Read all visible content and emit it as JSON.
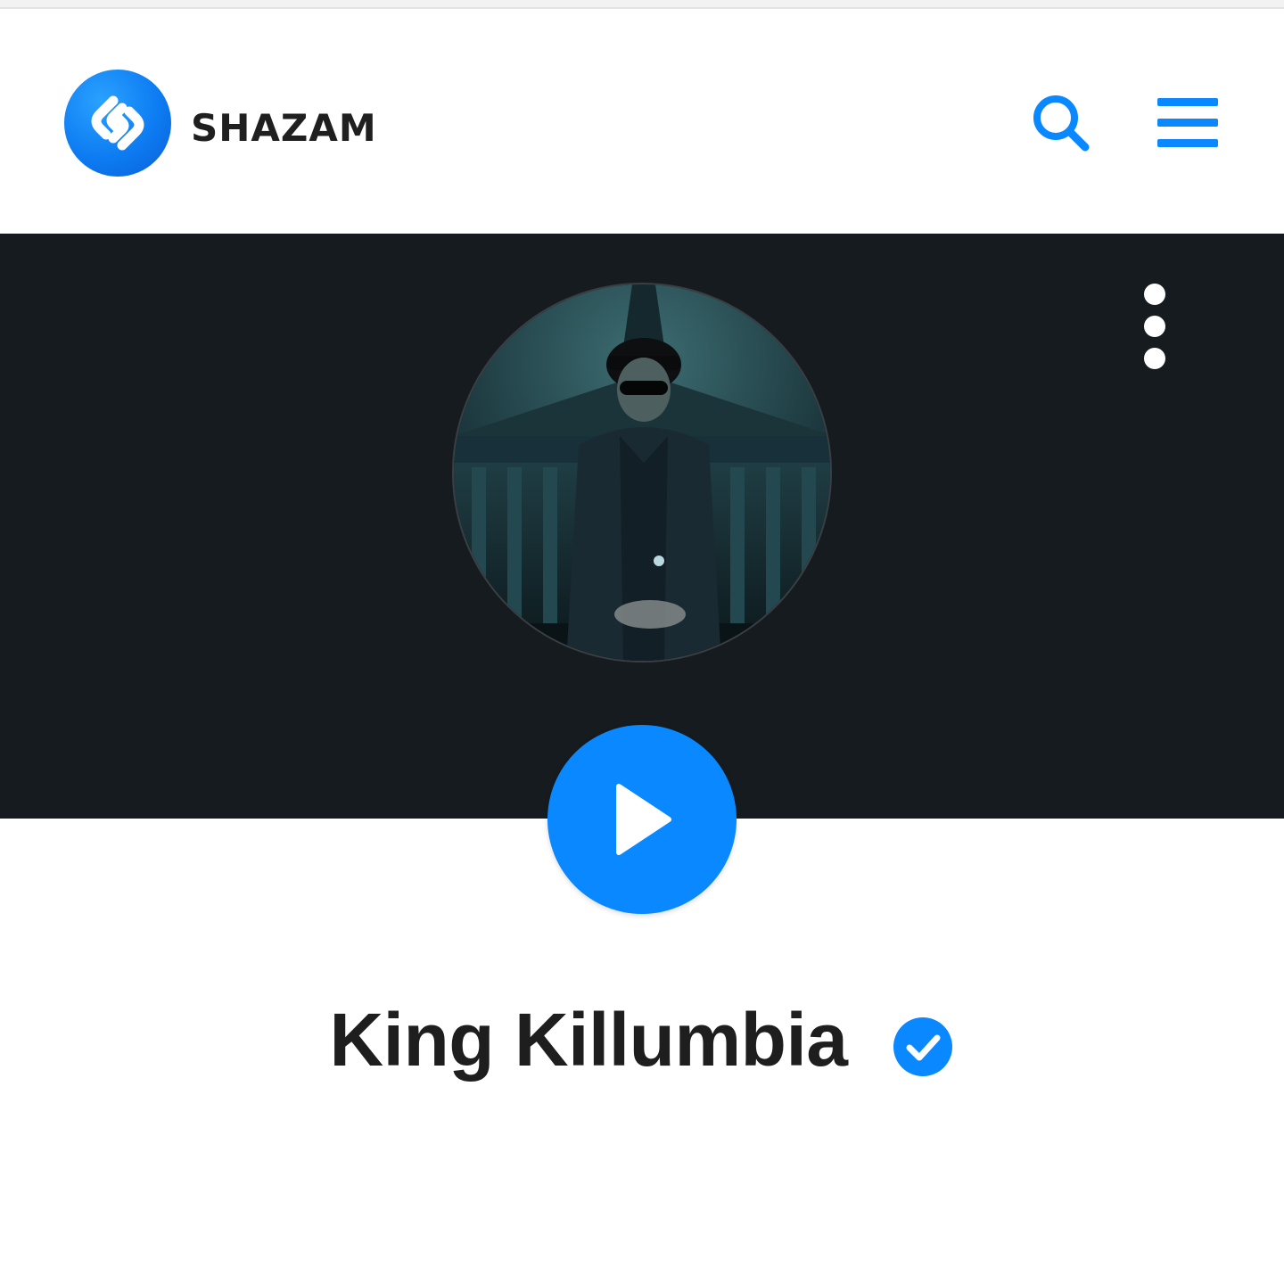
{
  "header": {
    "brand_name": "SHAZAM",
    "logo_icon": "shazam-logo-icon",
    "search_icon": "search-icon",
    "menu_icon": "hamburger-menu-icon"
  },
  "hero": {
    "more_icon": "more-options-icon",
    "avatar_icon": "artist-avatar-image",
    "play_icon": "play-icon"
  },
  "artist": {
    "name": "King Killumbia",
    "verified_icon": "verified-badge-icon"
  },
  "colors": {
    "accent": "#0a88ff",
    "hero_background": "#161b1f",
    "text": "#1e1e1e"
  }
}
